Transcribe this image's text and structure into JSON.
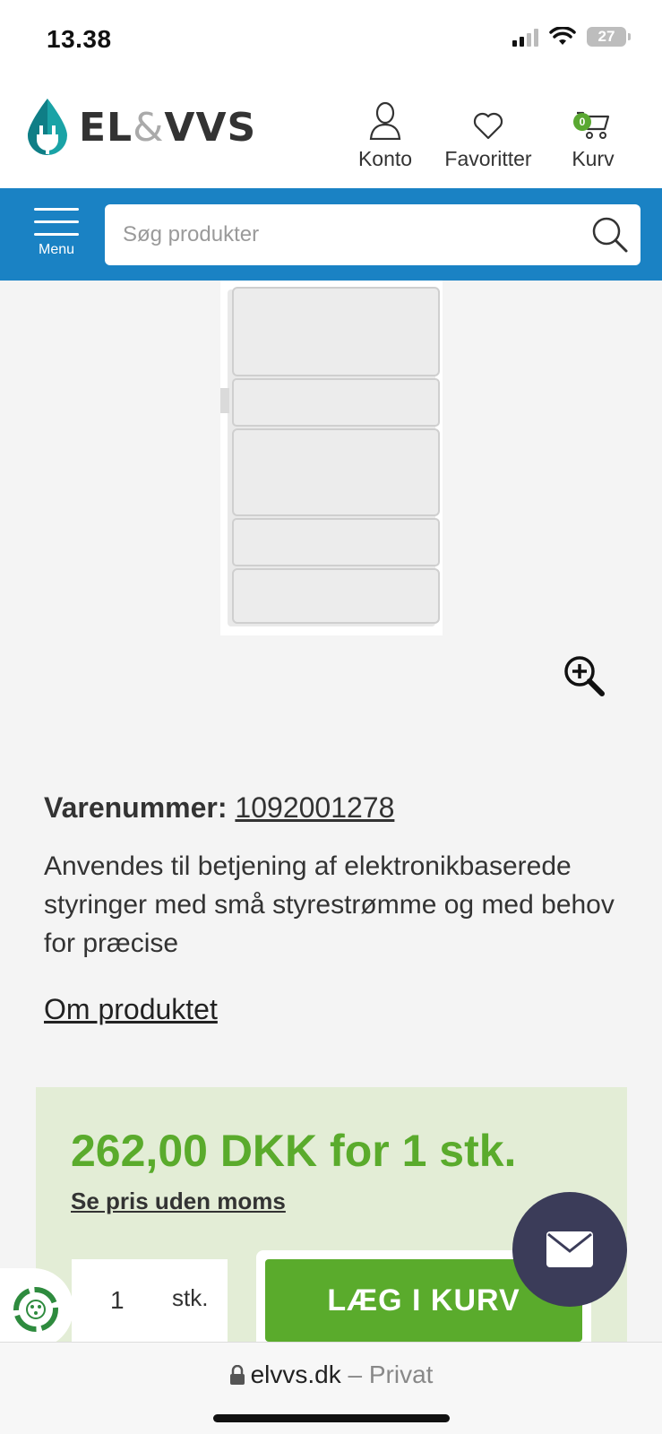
{
  "status_bar": {
    "time": "13.38",
    "battery": "27"
  },
  "header": {
    "logo_text_a": "EL",
    "logo_text_amp": "&",
    "logo_text_b": "VVS",
    "account_label": "Konto",
    "favorites_label": "Favoritter",
    "cart_label": "Kurv",
    "cart_count": "0"
  },
  "nav": {
    "menu_label": "Menu",
    "search_placeholder": "Søg produkter"
  },
  "product": {
    "sku_label": "Varenummer:",
    "sku": "1092001278",
    "description": "Anvendes til betjening af elektronikbaserede styringer med små styrestrømme og med behov for præcise",
    "about_link": "Om produktet"
  },
  "purchase": {
    "price": "262,00 DKK for 1 stk.",
    "excl_vat_link": "Se pris uden moms",
    "quantity": "1",
    "unit": "stk.",
    "add_to_cart": "LÆG I KURV"
  },
  "browser": {
    "domain": "elvvs.dk",
    "mode": "– Privat"
  },
  "colors": {
    "brand_blue": "#1a82c4",
    "price_green": "#5aab2c",
    "price_box": "#e3edd6",
    "chat_button": "#3b3c59"
  }
}
